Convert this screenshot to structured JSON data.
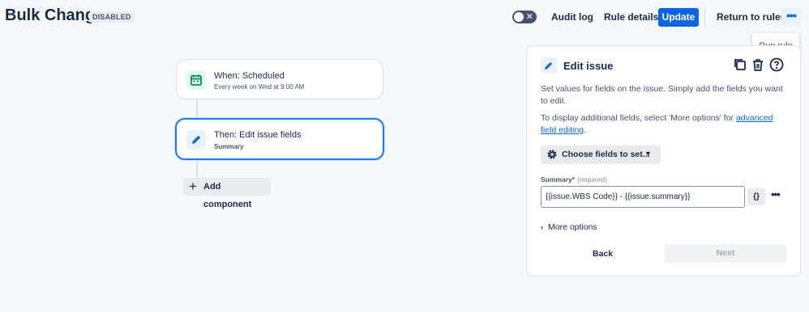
{
  "header": {
    "title": "Bulk Change",
    "status_badge": "DISABLED",
    "toggle_state": "off",
    "audit_log": "Audit log",
    "rule_details": "Rule details",
    "update": "Update",
    "return_to_rules": "Return to rules",
    "more_icon": "ellipsis-icon"
  },
  "dropdown": {
    "run_rule": "Run rule"
  },
  "flow": {
    "trigger": {
      "title": "When: Scheduled",
      "subtitle": "Every week on Wed at 9:00 AM",
      "icon": "calendar-icon"
    },
    "action": {
      "title": "Then: Edit issue fields",
      "subtitle": "Summary",
      "icon": "pencil-icon"
    },
    "add_component": "Add component"
  },
  "panel": {
    "title": "Edit issue",
    "description": "Set values for fields on the issue. Simply add the fields you want to edit.",
    "more_info_prefix": "To display additional fields, select 'More options' for ",
    "more_info_link": "advanced field editing",
    "more_info_suffix": ".",
    "choose_fields": "Choose fields to set...",
    "field": {
      "label": "Summary",
      "required_mark": "*",
      "required_text": "(required)",
      "value": "{{issue.WBS Code}} - {{issue.summary}}",
      "smart_value_button": "{}"
    },
    "more_options": "More options",
    "back": "Back",
    "next": "Next"
  },
  "colors": {
    "primary": "#0c66e4",
    "selected_border": "#1d7afc",
    "calendar_icon_bg": "#dcfff1",
    "calendar_icon_fg": "#1f845a"
  }
}
